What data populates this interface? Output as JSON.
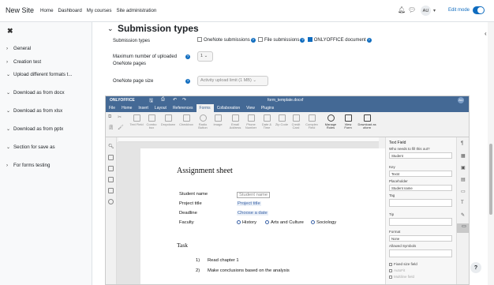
{
  "header": {
    "site_name": "New Site",
    "nav": [
      "Home",
      "Dashboard",
      "My courses",
      "Site administration"
    ],
    "avatar": "AU",
    "edit_mode_label": "Edit mode"
  },
  "drawer": {
    "items": [
      "General",
      "Creation test",
      "Upload different formats t...",
      "Download as from docx",
      "Download as from xlsx",
      "Download as from pptx",
      "Section for save as",
      "For forms testing"
    ]
  },
  "section": {
    "title": "Submission types",
    "submission_label": "Submission types",
    "onenote_label": "OneNote submissions",
    "file_label": "File submissions",
    "onlyoffice_label": "ONLYOFFICE document",
    "max_upload_label": "Maximum number of uploaded OneNote pages",
    "max_upload_value": "1",
    "page_size_label": "OneNote page size",
    "page_size_value": "Activity upload limit (1 MB)"
  },
  "editor": {
    "brand": "ONLYOFFICE",
    "filename": "form_template.docxf",
    "user_initials": "AU",
    "tabs": [
      "File",
      "Home",
      "Insert",
      "Layout",
      "References",
      "Forms",
      "Collaboration",
      "View",
      "Plugins"
    ],
    "active_tab": "Forms",
    "ribbon": [
      "Text Field",
      "Combo box",
      "Dropdown",
      "Checkbox",
      "Radio Button",
      "Image",
      "Email Address",
      "Phone Number",
      "Date & Time",
      "Zip Code",
      "Credit Card",
      "Complex Field",
      "Manage Roles",
      "View Form",
      "Download as oform"
    ],
    "document": {
      "heading": "Assignment  sheet",
      "rows": [
        {
          "label": "Student name",
          "field": "Student name"
        },
        {
          "label": "Project title",
          "field": "Project title"
        },
        {
          "label": "Deadline",
          "field": "Choose a date"
        }
      ],
      "faculty_label": "Faculty",
      "faculty_options": [
        "History",
        "Arts and Culture",
        "Sociology"
      ],
      "task_heading": "Task",
      "tasks": [
        {
          "num": "1)",
          "text": "Read chapter 1"
        },
        {
          "num": "2)",
          "text": "Make conclusions based on the analysis"
        }
      ]
    },
    "panel": {
      "title": "Text Field",
      "who_label": "Who needs to fill this out?",
      "who_value": "Student",
      "key_label": "Key",
      "key_value": "Text4",
      "placeholder_label": "Placeholder",
      "placeholder_value": "Student name",
      "tag_label": "Tag",
      "tip_label": "Tip",
      "format_label": "Format",
      "format_value": "None",
      "allowed_label": "Allowed Symbols",
      "fixed_label": "Fixed size field",
      "autofit_label": "AutoFit",
      "multiline_label": "Multiline field"
    }
  }
}
